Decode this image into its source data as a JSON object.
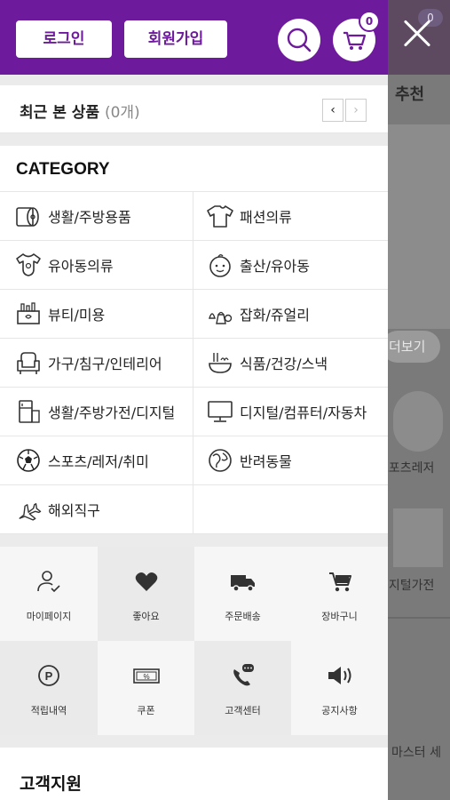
{
  "header": {
    "login_label": "로그인",
    "join_label": "회원가입",
    "cart_count": "0"
  },
  "recent": {
    "title": "최근 본 상품",
    "count": "(0개)",
    "prev_label": "‹",
    "next_label": "›"
  },
  "category": {
    "title": "CATEGORY",
    "items": [
      {
        "label": "생활/주방용품",
        "icon": "paper-towel-icon"
      },
      {
        "label": "패션의류",
        "icon": "tshirt-icon"
      },
      {
        "label": "유아동의류",
        "icon": "baby-bodysuit-icon"
      },
      {
        "label": "출산/유아동",
        "icon": "baby-face-icon"
      },
      {
        "label": "뷰티/미용",
        "icon": "cosmetics-icon"
      },
      {
        "label": "잡화/쥬얼리",
        "icon": "accessories-icon"
      },
      {
        "label": "가구/침구/인테리어",
        "icon": "armchair-icon"
      },
      {
        "label": "식품/건강/스낵",
        "icon": "food-bowl-icon"
      },
      {
        "label": "생활/주방가전/디지털",
        "icon": "refrigerator-icon"
      },
      {
        "label": "디지털/컴퓨터/자동차",
        "icon": "monitor-icon"
      },
      {
        "label": "스포츠/레저/취미",
        "icon": "soccer-ball-icon"
      },
      {
        "label": "반려동물",
        "icon": "pet-icon"
      },
      {
        "label": "해외직구",
        "icon": "airplane-icon"
      },
      {
        "label": "",
        "icon": ""
      }
    ]
  },
  "quick_menu": [
    {
      "label": "마이페이지",
      "icon": "user-check-icon"
    },
    {
      "label": "좋아요",
      "icon": "heart-icon"
    },
    {
      "label": "주문배송",
      "icon": "truck-icon"
    },
    {
      "label": "장바구니",
      "icon": "cart-icon"
    },
    {
      "label": "적립내역",
      "icon": "point-icon"
    },
    {
      "label": "쿠폰",
      "icon": "coupon-icon"
    },
    {
      "label": "고객센터",
      "icon": "phone-chat-icon"
    },
    {
      "label": "공지사항",
      "icon": "speaker-icon"
    }
  ],
  "support": {
    "title": "고객지원"
  },
  "background": {
    "cart_count": "0",
    "section_title": "추천",
    "more_button": "더보기",
    "item1": "스포츠레저",
    "item2": "디지털가전",
    "item3": "마스터 세"
  },
  "colors": {
    "brand": "#6d1a9c"
  }
}
